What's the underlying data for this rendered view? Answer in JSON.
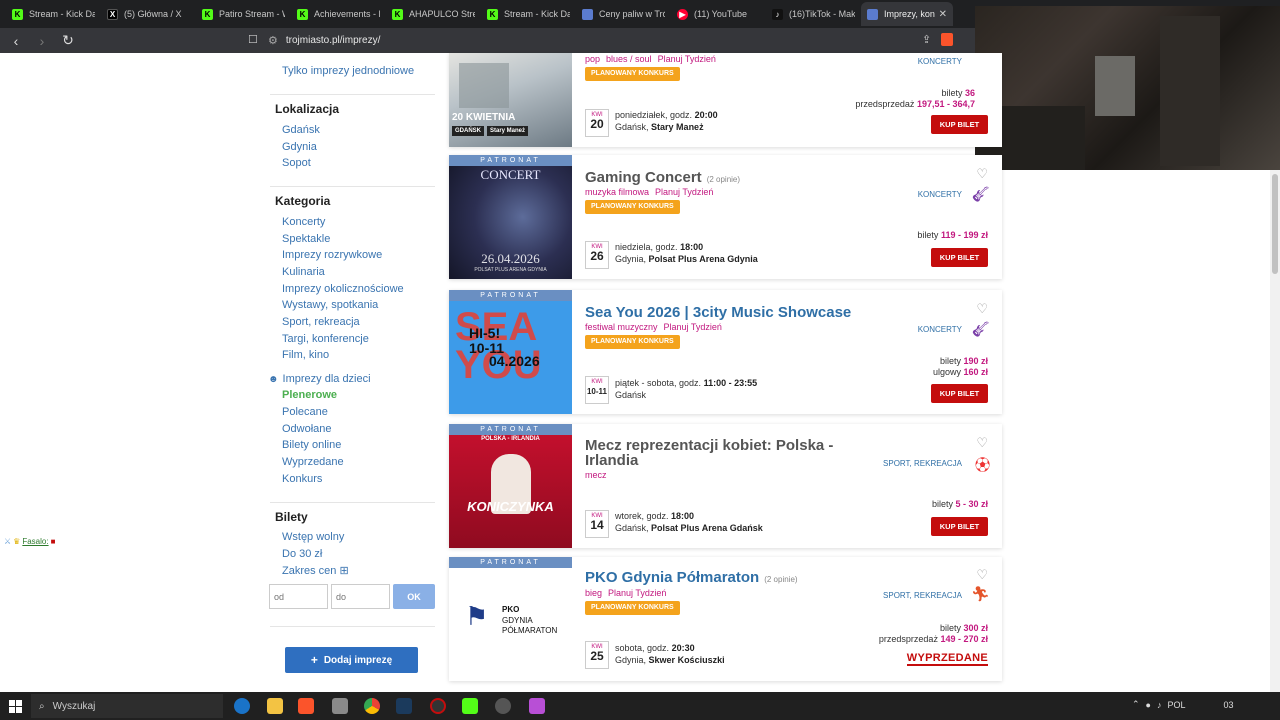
{
  "browser": {
    "tabs": [
      {
        "title": "Stream - Kick Da",
        "icon": "kick-icon"
      },
      {
        "title": "(5) Główna / X",
        "icon": "x-icon"
      },
      {
        "title": "Patiro Stream - W",
        "icon": "kick-icon"
      },
      {
        "title": "Achievements - K",
        "icon": "kick-icon"
      },
      {
        "title": "AHAPULCO Strea",
        "icon": "kick-icon"
      },
      {
        "title": "Stream - Kick Da",
        "icon": "kick-icon"
      },
      {
        "title": "Ceny paliw w Trój",
        "icon": "page-icon"
      },
      {
        "title": "(11) YouTube",
        "icon": "youtube-icon"
      },
      {
        "title": "(16)TikTok - Make",
        "icon": "tiktok-icon"
      },
      {
        "title": "Imprezy, kon",
        "icon": "page-icon",
        "active": true
      }
    ],
    "url": "trojmiasto.pl/imprezy/"
  },
  "sidebar": {
    "single_events": "Tylko imprezy jednodniowe",
    "location_heading": "Lokalizacja",
    "locations": [
      "Gdańsk",
      "Gdynia",
      "Sopot"
    ],
    "category_heading": "Kategoria",
    "categories": [
      "Koncerty",
      "Spektakle",
      "Imprezy rozrywkowe",
      "Kulinaria",
      "Imprezy okolicznościowe",
      "Wystawy, spotkania",
      "Sport, rekreacja",
      "Targi, konferencje",
      "Film, kino"
    ],
    "kids": "Imprezy dla dzieci",
    "plenerowe": "Plenerowe",
    "extras": [
      "Polecane",
      "Odwołane",
      "Bilety online",
      "Wyprzedane",
      "Konkurs"
    ],
    "tickets_heading": "Bilety",
    "tickets": [
      "Wstęp wolny",
      "Do 30 zł"
    ],
    "price_range": "Zakres cen",
    "price_range_icon": "plus-box-icon",
    "from_placeholder": "od",
    "to_placeholder": "do",
    "ok": "OK",
    "add_event": "Dodaj imprezę"
  },
  "stream_overlay": {
    "chat_name": "Fasalo:"
  },
  "events": [
    {
      "poster_text": "20 KWIETNIA",
      "poster_sub1": "GDAŃSK",
      "poster_sub2": "Stary Maneż",
      "tags": [
        "pop",
        "blues / soul",
        "Planuj Tydzień"
      ],
      "badge": "PLANOWANY KONKURS",
      "category": "KONCERTY",
      "month": "KWI",
      "day": "20",
      "dayname": "poniedziałek, godz.",
      "time": "20:00",
      "city": "Gdańsk,",
      "venue": "Stary Maneż",
      "price_label1": "bilety",
      "price_value1": "36",
      "price_label2": "przedsprzedaż",
      "price_value2": "197,51 - 364,7",
      "button": "KUP BILET"
    },
    {
      "patronat": "PATRONAT",
      "poster_title": "CONCERT",
      "poster_date": "26.04.2026",
      "poster_venue": "POLSAT PLUS ARENA GDYNIA",
      "title": "Gaming Concert",
      "opinions": "(2 opinie)",
      "tags": [
        "muzyka filmowa",
        "Planuj Tydzień"
      ],
      "badge": "PLANOWANY KONKURS",
      "category": "KONCERTY",
      "month": "KWI",
      "day": "26",
      "dayname": "niedziela, godz.",
      "time": "18:00",
      "city": "Gdynia,",
      "venue": "Polsat Plus Arena Gdynia",
      "price_label1": "bilety",
      "price_value1": "119 - 199 zł",
      "button": "KUP BILET"
    },
    {
      "patronat": "PATRONAT",
      "poster_line1": "HI-5!",
      "poster_line2": "10-11",
      "poster_line3": "04.2026",
      "title": "Sea You 2026 | 3city Music Showcase",
      "tags": [
        "festiwal muzyczny",
        "Planuj Tydzień"
      ],
      "badge": "PLANOWANY KONKURS",
      "category": "KONCERTY",
      "month": "KWI",
      "day": "10-11",
      "dayname": "piątek - sobota, godz.",
      "time": "11:00 - 23:55",
      "city": "Gdańsk",
      "venue": "",
      "price_label1": "bilety",
      "price_value1": "190 zł",
      "price_label2": "ulgowy",
      "price_value2": "160 zł",
      "button": "KUP BILET"
    },
    {
      "patronat": "PATRONAT",
      "poster_head": "POLSKA - IRLANDIA",
      "poster_name": "KONICZYNKA",
      "title": "Mecz reprezentacji kobiet: Polska - Irlandia",
      "tags": [
        "mecz"
      ],
      "category": "SPORT, REKREACJA",
      "month": "KWI",
      "day": "14",
      "dayname": "wtorek, godz.",
      "time": "18:00",
      "city": "Gdańsk,",
      "venue": "Polsat Plus Arena Gdańsk",
      "price_label1": "bilety",
      "price_value1": "5 - 30 zł",
      "button": "KUP BILET"
    },
    {
      "patronat": "PATRONAT",
      "poster_logo1": "PKO",
      "poster_logo2": "GDYNIA",
      "poster_logo3": "PÓŁMARATON",
      "title": "PKO Gdynia Półmaraton",
      "opinions": "(2 opinie)",
      "tags": [
        "bieg",
        "Planuj Tydzień"
      ],
      "badge": "PLANOWANY KONKURS",
      "category": "SPORT, REKREACJA",
      "month": "KWI",
      "day": "25",
      "dayname": "sobota, godz.",
      "time": "20:30",
      "city": "Gdynia,",
      "venue": "Skwer Kościuszki",
      "price_label1": "bilety",
      "price_value1": "300 zł",
      "price_label2": "przedsprzedaż",
      "price_value2": "149 - 270 zł",
      "button": "WYPRZEDANE"
    }
  ],
  "taskbar": {
    "search": "Wyszukaj",
    "lang": "POL",
    "clock": "03"
  },
  "colors": {
    "accent": "#2f6fa6",
    "tag": "#c2187f",
    "buy": "#c40d0d",
    "badge": "#f4a31c"
  }
}
